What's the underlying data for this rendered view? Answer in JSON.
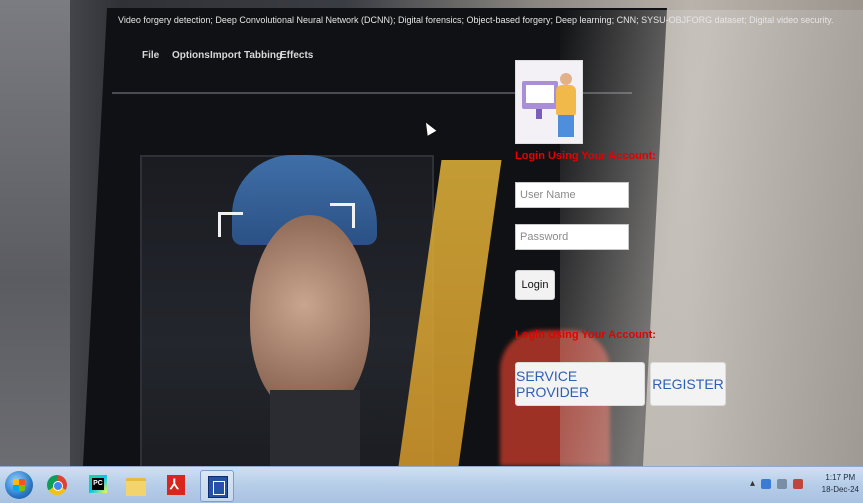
{
  "background": {
    "keywords": "Video forgery detection; Deep Convolutional Neural Network (DCNN); Digital forensics; Object-based forgery; Deep learning; CNN; SYSU-OBJFORG dataset; Digital video security.",
    "menu": [
      "File",
      "Options",
      "Import",
      "Tabbing",
      "Effects"
    ]
  },
  "login": {
    "heading": "Login Using Your Account:",
    "username_placeholder": "User Name",
    "password_placeholder": "Password",
    "login_button": "Login",
    "heading_2": "Login Using Your Account:",
    "service_provider_button": "SERVICE PROVIDER",
    "register_button": "REGISTER"
  },
  "taskbar": {
    "apps": [
      "start",
      "chrome",
      "pycharm",
      "file-explorer",
      "acrobat",
      "app"
    ],
    "clock_time": "1:17 PM",
    "clock_date": "18-Dec-24"
  },
  "colors": {
    "heading_red": "#e60000",
    "button_text_blue": "#2f5fb4"
  }
}
